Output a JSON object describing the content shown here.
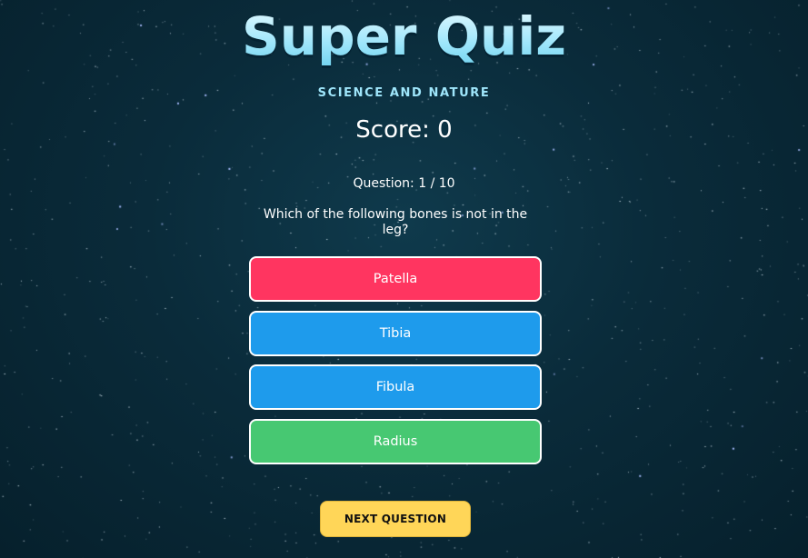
{
  "title": "Super Quiz",
  "category": "SCIENCE AND NATURE",
  "score_text": "Score: 0",
  "question_counter": "Question: 1 / 10",
  "question": "Which of the following bones is not in the leg?",
  "answers": [
    {
      "label": "Patella",
      "state": "wrong",
      "color": "#ff3560"
    },
    {
      "label": "Tibia",
      "state": "neutral",
      "color": "#1e9bec"
    },
    {
      "label": "Fibula",
      "state": "neutral",
      "color": "#1e9bec"
    },
    {
      "label": "Radius",
      "state": "correct",
      "color": "#47c872"
    }
  ],
  "next_button": "NEXT QUESTION",
  "colors": {
    "background": "#0a2b3a",
    "title": "#9fe6fb",
    "next_button": "#ffd658"
  }
}
